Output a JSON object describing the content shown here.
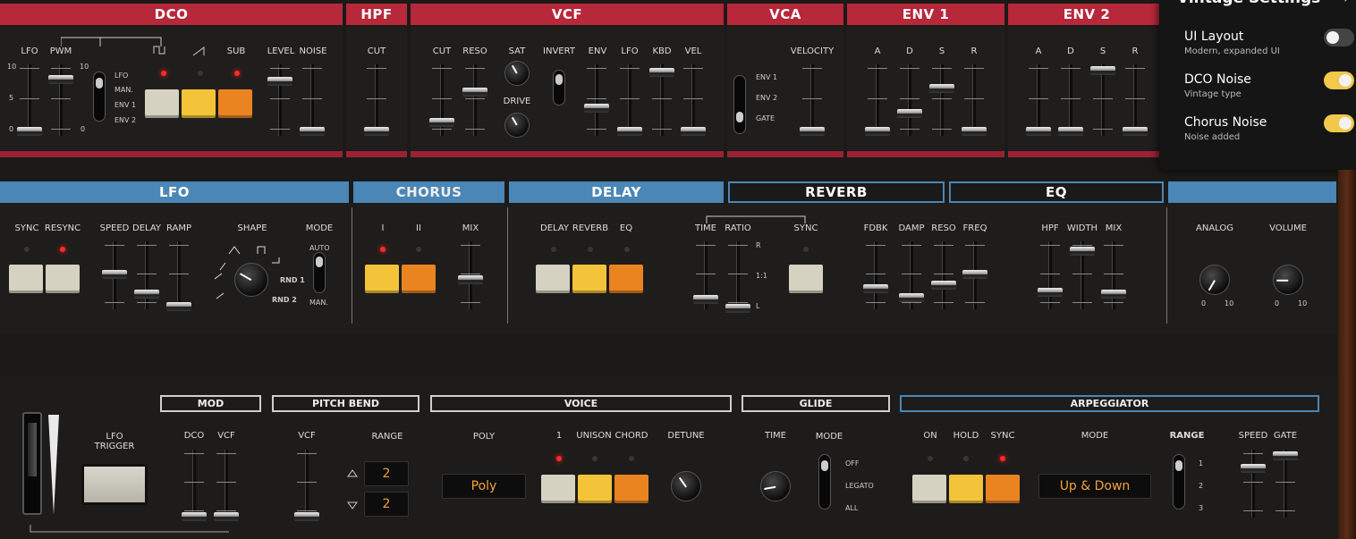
{
  "colors": {
    "red": "#b6283a",
    "blue": "#4a86b6",
    "led_on": "#ff2a2a",
    "display": "#f2a23a"
  },
  "top": {
    "headers": [
      "DCO",
      "HPF",
      "VCF",
      "VCA",
      "ENV 1",
      "ENV 2"
    ],
    "dco": {
      "labels": [
        "LFO",
        "PWM",
        "SUB",
        "LEVEL",
        "NOISE"
      ],
      "source": [
        "LFO",
        "MAN.",
        "ENV 1",
        "ENV 2"
      ]
    },
    "hpf": {
      "label": "CUT"
    },
    "vcf": {
      "labels": [
        "CUT",
        "RESO",
        "SAT",
        "DRIVE",
        "INVERT",
        "ENV",
        "LFO",
        "KBD",
        "VEL"
      ]
    },
    "vca": {
      "label": "VELOCITY",
      "modes": [
        "ENV 1",
        "ENV 2",
        "GATE"
      ]
    },
    "env1": [
      "A",
      "D",
      "S",
      "R"
    ],
    "env2": [
      "A",
      "D",
      "S",
      "R"
    ],
    "scale": {
      "max": "10",
      "mid": "5",
      "min": "0"
    }
  },
  "settings": {
    "title": "Vintage Settings",
    "close": "›",
    "rows": [
      {
        "title": "UI Layout",
        "sub": "Modern, expanded UI",
        "on": false
      },
      {
        "title": "DCO Noise",
        "sub": "Vintage type",
        "on": true
      },
      {
        "title": "Chorus Noise",
        "sub": "Noise added",
        "on": true
      }
    ]
  },
  "mid": {
    "headers": [
      "LFO",
      "CHORUS",
      "DELAY",
      "REVERB",
      "EQ"
    ],
    "lfo": {
      "labels": [
        "SYNC",
        "RESYNC",
        "SPEED",
        "DELAY",
        "RAMP",
        "SHAPE",
        "MODE"
      ],
      "modes": [
        "AUTO",
        "MAN."
      ],
      "rnd": [
        "RND 1",
        "RND 2"
      ]
    },
    "chorus": {
      "labels": [
        "I",
        "II",
        "MIX"
      ]
    },
    "delay": {
      "labels": [
        "DELAY",
        "REVERB",
        "EQ",
        "TIME",
        "RATIO",
        "SYNC"
      ],
      "ratio_marks": [
        "R",
        "1:1",
        "L"
      ]
    },
    "reverb": {
      "labels": [
        "FDBK",
        "DAMP",
        "RESO",
        "FREQ"
      ]
    },
    "eq": {
      "labels": [
        "HPF",
        "WIDTH",
        "MIX"
      ]
    },
    "out": {
      "labels": [
        "ANALOG",
        "VOLUME"
      ],
      "knob_min": "0",
      "knob_max": "10"
    }
  },
  "bottom": {
    "lfo_trigger": "LFO TRIGGER",
    "boxes": [
      "MOD",
      "PITCH BEND",
      "VOICE",
      "GLIDE",
      "ARPEGGIATOR"
    ],
    "mod": [
      "DCO",
      "VCF"
    ],
    "pitch": {
      "vcf": "VCF",
      "range": "RANGE",
      "up": "2",
      "down": "2"
    },
    "voice": {
      "poly_label": "POLY",
      "poly": "Poly",
      "btn_labels": [
        "1",
        "UNISON",
        "CHORD"
      ],
      "detune": "DETUNE"
    },
    "glide": {
      "time": "TIME",
      "mode": "MODE",
      "modes": [
        "OFF",
        "LEGATO",
        "ALL"
      ]
    },
    "arp": {
      "labels": [
        "ON",
        "HOLD",
        "SYNC"
      ],
      "mode_label": "MODE",
      "mode": "Up & Down",
      "range": "RANGE",
      "ranges": [
        "1",
        "2",
        "3"
      ],
      "speed": "SPEED",
      "gate": "GATE"
    }
  }
}
